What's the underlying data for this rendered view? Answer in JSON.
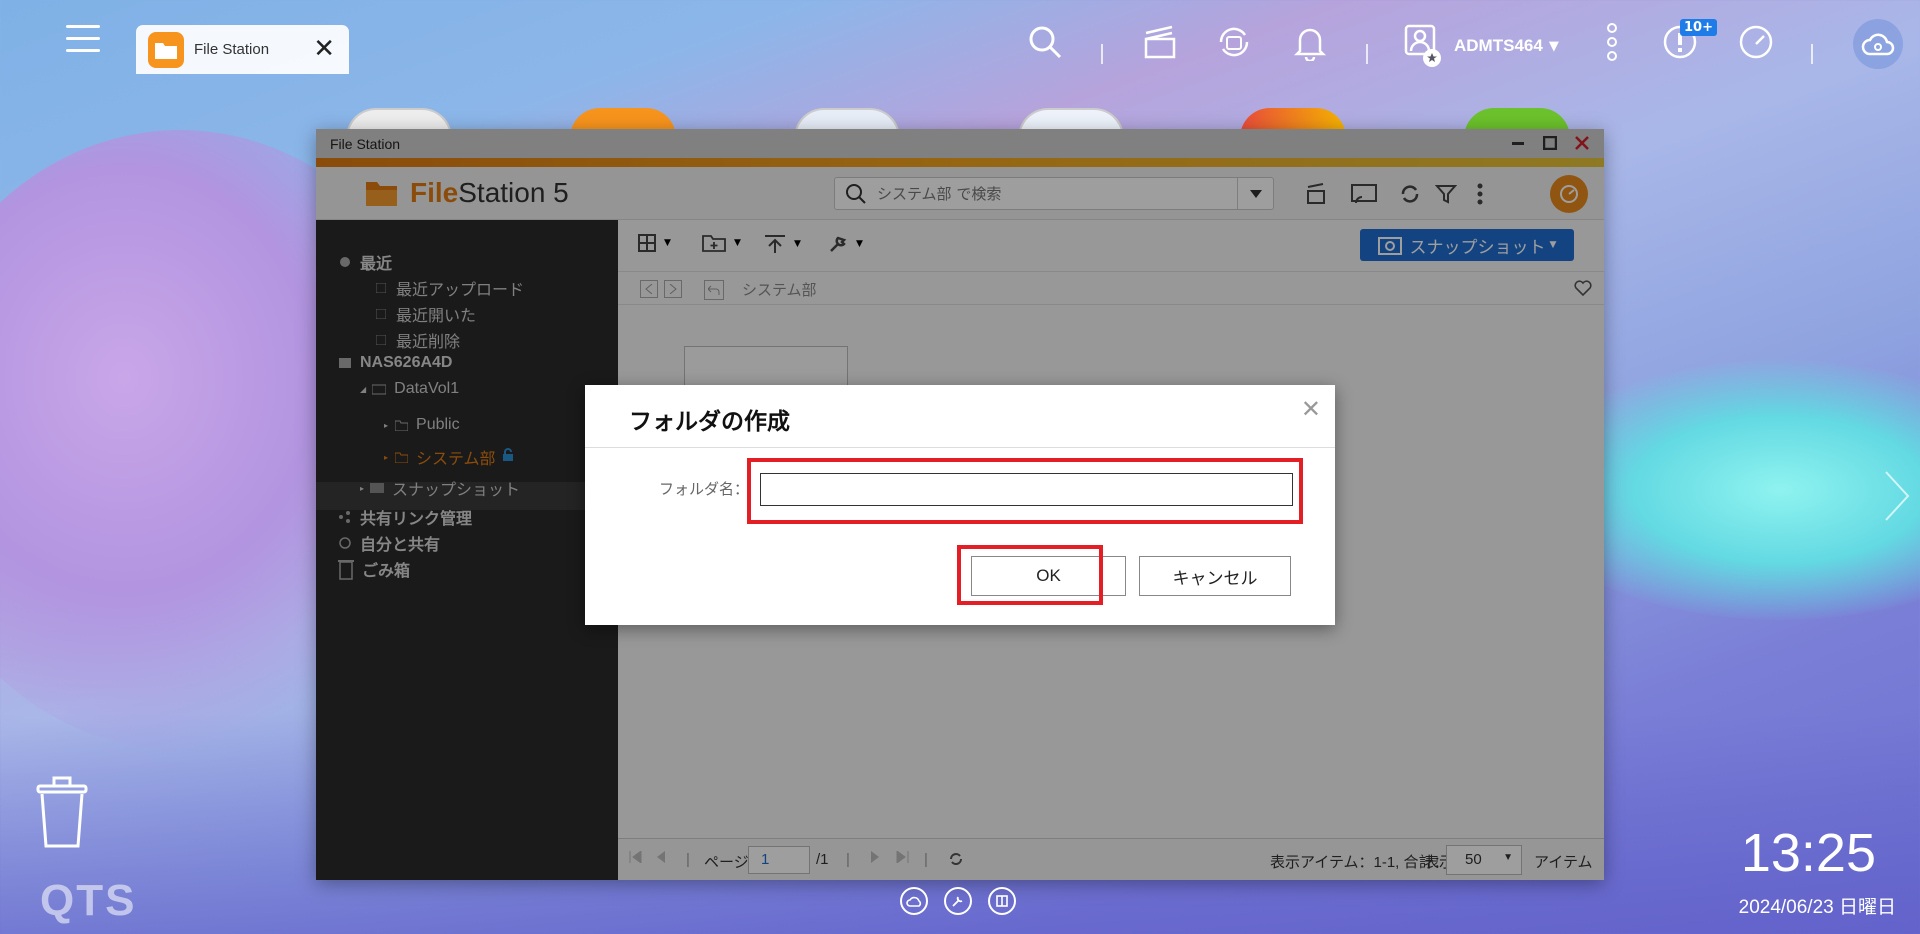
{
  "taskbar": {
    "app_label": "File Station",
    "close_glyph": "✕",
    "username": "ADMTS464",
    "notification_badge": "10+"
  },
  "window": {
    "title": "File Station",
    "app_name_bold": "File",
    "app_name_rest": "Station 5",
    "search_placeholder": "システム部 で検索"
  },
  "sidebar": {
    "recent": "最近",
    "recent_upload": "最近アップロード",
    "recent_opened": "最近開いた",
    "recent_deleted": "最近削除",
    "nas": "NAS626A4D",
    "volume": "DataVol1",
    "folder_public": "Public",
    "folder_system": "システム部",
    "snapshot": "スナップショット",
    "share_link": "共有リンク管理",
    "shared_with_me": "自分と共有",
    "trash": "ごみ箱"
  },
  "toolbar": {
    "snapshot_button": "スナップショット"
  },
  "path": {
    "current": "システム部"
  },
  "footer": {
    "page_label": "ページ",
    "page_value": "1",
    "page_total": "/1",
    "summary": "表示アイテム：1-1, 合計：1",
    "display_label": "表示",
    "per_page": "50",
    "items_label": "アイテム"
  },
  "dialog": {
    "title": "フォルダの作成",
    "folder_name_label": "フォルダ名：",
    "folder_name_value": "",
    "ok": "OK",
    "cancel": "キャンセル"
  },
  "desktop": {
    "brand": "QTS",
    "time": "13:25",
    "date": "2024/06/23 日曜日"
  },
  "colors": {
    "accent_orange": "#e07b12",
    "snapshot_blue": "#1f6fd1",
    "highlight_red": "#e31e24"
  }
}
